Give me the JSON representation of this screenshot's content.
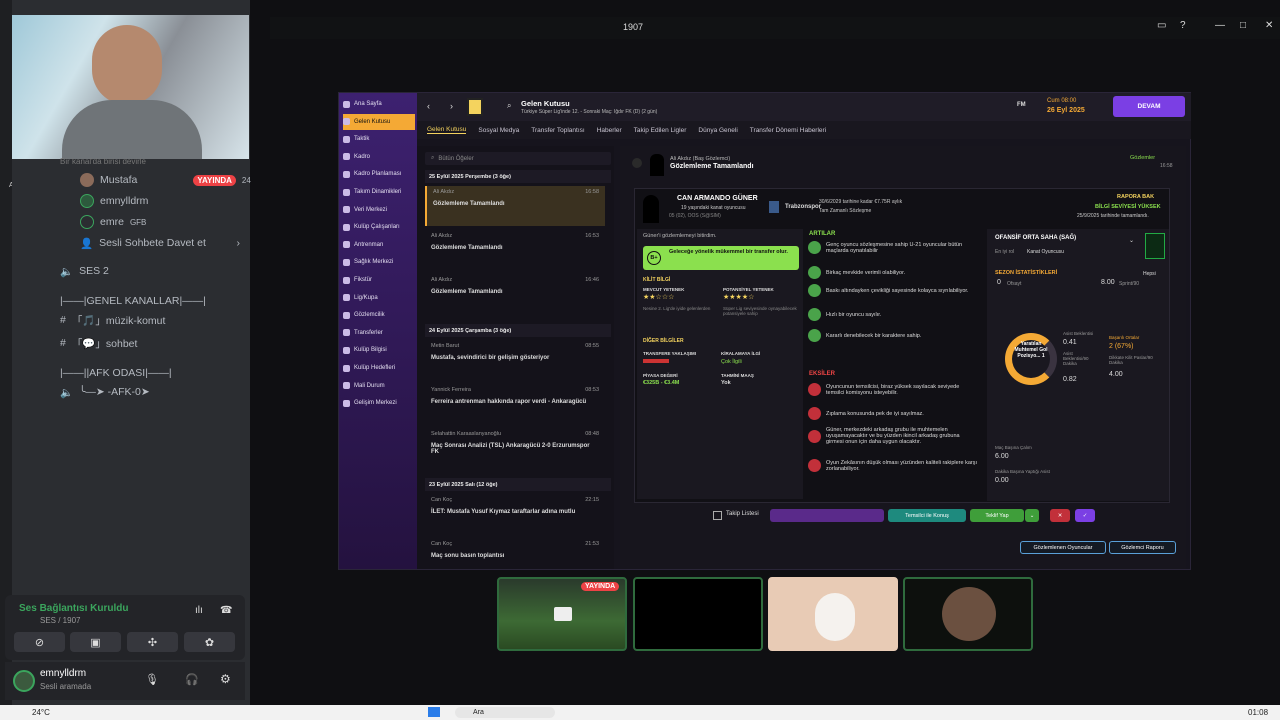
{
  "window": {
    "title": "1907"
  },
  "discord": {
    "rail_badge": "107",
    "rail_label": "AILI",
    "channel_partial": "Bir kanal'da birisi devirle",
    "voice_members": [
      {
        "name": "Mustafa",
        "live": "YAYINDA",
        "count": "24"
      },
      {
        "name": "emnylldrm"
      },
      {
        "name": "emre",
        "tag": "GFB"
      }
    ],
    "invite": "Sesli Sohbete Davet et",
    "voice_channel_2": "SES 2",
    "category_general": "|——|GENEL KANALLAR|——|",
    "channel_music": "「🎵」müzik-komut",
    "channel_chat": "「💬」sohbet",
    "category_afk": "|——||AFK ODASI|——|",
    "channel_afk": "╰—➤ -AFK-0➤",
    "voice_status": "Ses Bağlantısı Kuruldu",
    "voice_sub": "SES / 1907",
    "user": {
      "name": "emnylldrm",
      "status": "Sesli aramada"
    }
  },
  "fm": {
    "sidebar": [
      "Ana Sayfa",
      "Gelen Kutusu",
      "Taktik",
      "Kadro",
      "Kadro Planlaması",
      "Takım Dinamikleri",
      "Veri Merkezi",
      "Kulüp Çalışanları",
      "Antrenman",
      "Sağlık Merkezi",
      "Fikstür",
      "Lig/Kupa",
      "Gözlemcilik",
      "Transferler",
      "Kulüp Bilgisi",
      "Kulüp Hedefleri",
      "Mali Durum",
      "Gelişim Merkezi"
    ],
    "header_title": "Gelen Kutusu",
    "header_sub": "Türkiye Süper Lig'inde 12. - Sonraki Maç: Iğdır FK (D) (2 gün)",
    "fm_label": "FM",
    "date_day": "Cum 08:00",
    "date": "26 Eyl 2025",
    "continue": "DEVAM",
    "tabs": [
      "Gelen Kutusu",
      "Sosyal Medya",
      "Transfer Toplantısı",
      "Haberler",
      "Takip Edilen Ligler",
      "Dünya Geneli",
      "Transfer Dönemi Haberleri"
    ],
    "search_placeholder": "Bütün Öğeler",
    "inbox_groups": [
      {
        "date": "25 Eylül 2025 Perşembe (3 öğe)",
        "items": [
          {
            "from": "Ali Akdız",
            "time": "16:58",
            "title": "Gözlemleme Tamamlandı"
          },
          {
            "from": "Ali Akdız",
            "time": "16:53",
            "title": "Gözlemleme Tamamlandı"
          },
          {
            "from": "Ali Akdız",
            "time": "16:46",
            "title": "Gözlemleme Tamamlandı"
          }
        ]
      },
      {
        "date": "24 Eylül 2025 Çarşamba (3 öğe)",
        "items": [
          {
            "from": "Metin Barut",
            "time": "08:55",
            "title": "Mustafa, sevindirici bir gelişim gösteriyor"
          },
          {
            "from": "Yannick Ferreira",
            "time": "08:53",
            "title": "Ferreira antrenman hakkında rapor verdi - Ankaragücü"
          },
          {
            "from": "Selahattin Karaaslanyanoğlu",
            "time": "08:48",
            "title": "Maç Sonrası Analizi (TSL) Ankaragücü 2-0 Erzurumspor FK"
          }
        ]
      },
      {
        "date": "23 Eylül 2025 Salı (12 öğe)",
        "items": [
          {
            "from": "Can Koç",
            "time": "22:15",
            "title": "İLET: Mustafa Yusuf Kıymaz taraftarlar adına mutlu"
          },
          {
            "from": "Can Koç",
            "time": "21:53",
            "title": "Maç sonu basın toplantısı"
          }
        ]
      }
    ],
    "detail": {
      "from": "Ali Akdız (Baş Gözlemci)",
      "title": "Gözlemleme Tamamlandı",
      "tag": "Gözlemler",
      "tag_time": "16:58",
      "player_name": "CAN ARMANDO GÜNER",
      "player_sub": "19 yaşındaki kanat oyuncusu",
      "player_sub2": "05 (02), OOS (S@SIM)",
      "club": "Trabzonspor",
      "contract": "30/6/2029 tarihine kadar €7.75R aylık",
      "contract2": "Tam Zamanlı Sözleşme",
      "report_link": "RAPORA BAK",
      "report_level": "BİLGİ SEVİYESİ YÜKSEK",
      "report_date": "25/9/2025 tarihinde tamamlandı.",
      "intro": "Güner'i gözlemlemeyi bitirdim.",
      "verdict": "Geleceğe yönelik mükemmel bir transfer olur.",
      "verdict_grade": "B+",
      "key_info": "KİLİT BİLGİ",
      "current_ability": "MEVCUT YETENEK",
      "potential_ability": "POTANSİYEL YETENEK",
      "current_note": "Nesine 2. Lig'de iyide gelenlerden",
      "potential_note": "Süper Lig seviyesinde oynayabilecek potansiyele sahip",
      "other_info": "DİĞER BİLGİLER",
      "transfer_approach": "TRANSFERE YAKLAŞIMI",
      "loan_interest": "KİRALAMAYA İLGİ",
      "loan_value": "Çok İlgili",
      "market_value": "PİYASA DEĞERİ",
      "market_value_val": "€325B - €3.4M",
      "wage": "TAHMİNİ MAAŞ",
      "wage_val": "Yok",
      "pros_title": "ARTILAR",
      "pros": [
        "Genç oyuncu sözleşmesine sahip U-21 oyuncular bütün maçlarda oynatılabilir",
        "Birkaç mevkide verimli olabiliyor.",
        "Baskı altındayken çevikliği sayesinde kolayca sıyrılabiliyor.",
        "Hızlı bir oyuncu sayılır.",
        "Kararlı denebilecek bir karaktere sahip."
      ],
      "cons_title": "EKSİLER",
      "cons": [
        "Oyuncunun temsilcisi, biraz yüksek sayılacak seviyede temsilci komisyonu isteyebilir.",
        "Zıplama konusunda pek de iyi sayılmaz.",
        "Güner, merkezdeki arkadaş grubu ile muhtemelen uyuşamayacaktır ve bu yüzden ikincil arkadaş grubuna girmesi onun için daha uygun olacaktır.",
        "Oyun Zekâsının düşük olması yüzünden kaliteli rakiplere karşı zorlanabiliyor."
      ],
      "position": "OFANSİF ORTA SAHA (SAĞ)",
      "best_role_label": "En iyi rol",
      "best_role": "Kanat Oyuncusu",
      "season_stats": "SEZON İSTATİSTİKLERİ",
      "season_filter": "Hepsi",
      "offside": "0",
      "offside_label": "Ofsayt",
      "sprint": "8.00",
      "sprint_label": "Sprint/90",
      "gauge_label": "Yaratılan Muhtemel Gol Pozisyo... 1",
      "stat1_label": "Asist Beklentisi",
      "stat1": "0.41",
      "stat2_label": "Asist Beklentisi/90 Dakika",
      "stat2": "0.82",
      "stat3_label": "Başarılı Ortalar",
      "stat3": "2 (67%)",
      "stat4_label": "Dikkate Kilit Paslar/90 Dakika",
      "stat4": "4.00",
      "stat5_label": "Maç Başına Çalım",
      "stat5": "6.00",
      "stat6_label": "Dakika Başına Yaptığı Asist",
      "stat6": "0.00",
      "watchlist": "Takip Listesi",
      "talk_agent": "Temsilci ile Konuş",
      "make_offer": "Teklif Yap",
      "btn_scouted": "Gözlemlenen Oyuncular",
      "btn_report": "Gözlemci Raporu"
    }
  },
  "stream_thumbs": {
    "live": "YAYINDA"
  },
  "taskbar": {
    "weather": "24°C",
    "time": "01:08",
    "search": "Ara"
  },
  "colors": {
    "accent": "#7b3fe4",
    "fm_yellow": "#f4d35e",
    "live_red": "#ed4245",
    "good_green": "#8be04e"
  }
}
